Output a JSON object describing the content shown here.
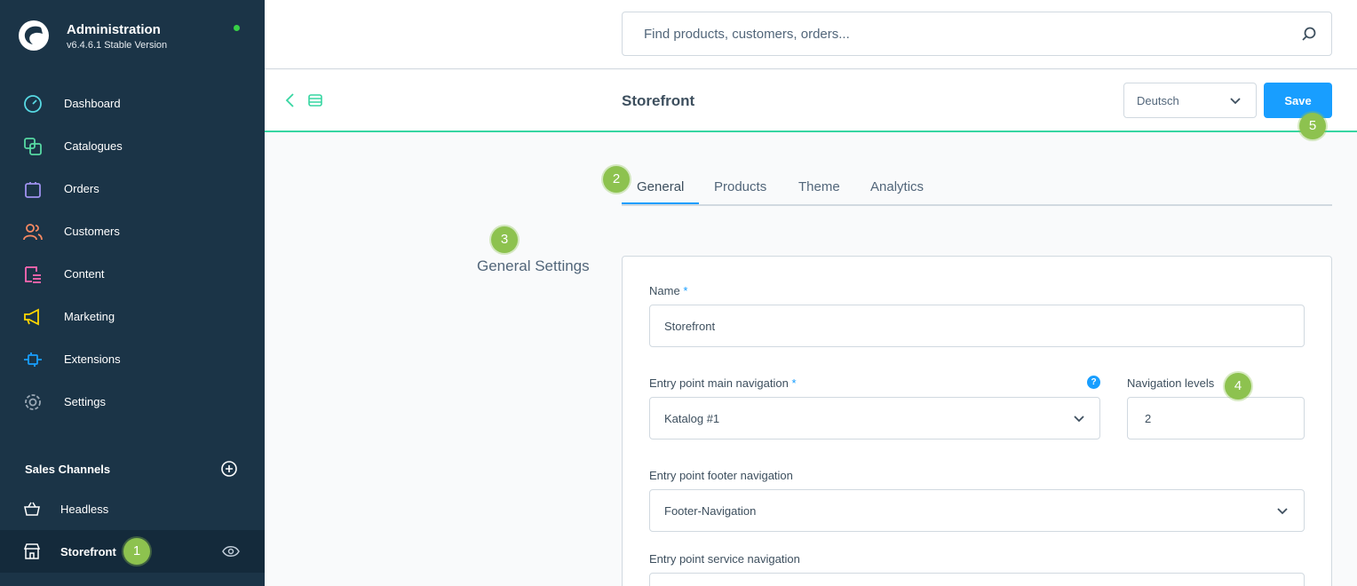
{
  "brand": {
    "title": "Administration",
    "version": "v6.4.6.1 Stable Version"
  },
  "sidebar": {
    "items": [
      {
        "label": "Dashboard"
      },
      {
        "label": "Catalogues"
      },
      {
        "label": "Orders"
      },
      {
        "label": "Customers"
      },
      {
        "label": "Content"
      },
      {
        "label": "Marketing"
      },
      {
        "label": "Extensions"
      },
      {
        "label": "Settings"
      }
    ],
    "sales_channels": {
      "header": "Sales Channels",
      "items": [
        {
          "label": "Headless"
        },
        {
          "label": "Storefront"
        }
      ]
    }
  },
  "search": {
    "placeholder": "Find products, customers, orders..."
  },
  "smartbar": {
    "title": "Storefront",
    "language": "Deutsch",
    "save_label": "Save"
  },
  "tabs": [
    {
      "label": "General"
    },
    {
      "label": "Products"
    },
    {
      "label": "Theme"
    },
    {
      "label": "Analytics"
    }
  ],
  "section": {
    "title": "General Settings"
  },
  "form": {
    "name": {
      "label": "Name",
      "required": "*",
      "value": "Storefront"
    },
    "main_nav": {
      "label": "Entry point main navigation",
      "required": "*",
      "value": "Katalog #1",
      "help": "?"
    },
    "nav_levels": {
      "label": "Navigation levels",
      "value": "2"
    },
    "footer_nav": {
      "label": "Entry point footer navigation",
      "value": "Footer-Navigation"
    },
    "service_nav": {
      "label": "Entry point service navigation"
    }
  },
  "badges": [
    "1",
    "2",
    "3",
    "4",
    "5"
  ],
  "colors": {
    "sidebar": "#1b3447",
    "accent": "#189eff",
    "smartbar_border": "#37d6a2",
    "badge": "#8dc24f",
    "status": "#37d046"
  }
}
